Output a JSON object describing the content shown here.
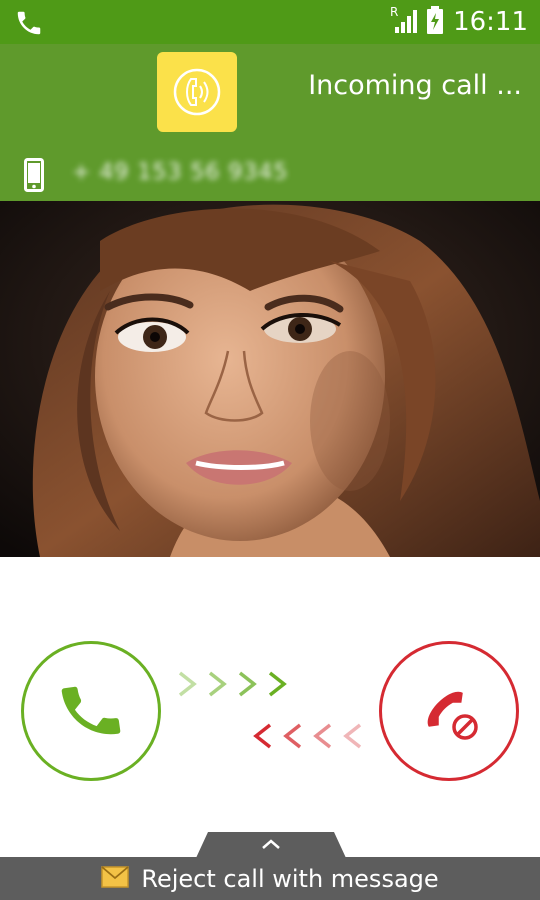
{
  "status_bar": {
    "time": "16:11",
    "network_label": "R",
    "left_icon": "phone-icon",
    "icons": [
      "signal-icon",
      "battery-charging-icon"
    ]
  },
  "header": {
    "title": "Incoming call  ...",
    "caller_number": "+ 49 153 56 9345",
    "app_icon": "phone-call-icon",
    "number_icon": "mobile-phone-icon"
  },
  "actions": {
    "answer_icon": "phone-answer-icon",
    "reject_icon": "phone-reject-icon",
    "answer_color": "#6ab023",
    "reject_color": "#d52a32"
  },
  "bottom": {
    "reject_message_label": "Reject call with message",
    "icon": "envelope-icon",
    "handle_icon": "chevron-up-icon"
  },
  "colors": {
    "status_bar": "#4f9a17",
    "header": "#5f9a2c",
    "app_icon_bg": "#fbe14a",
    "bottom_bar": "#5d5d5d"
  }
}
